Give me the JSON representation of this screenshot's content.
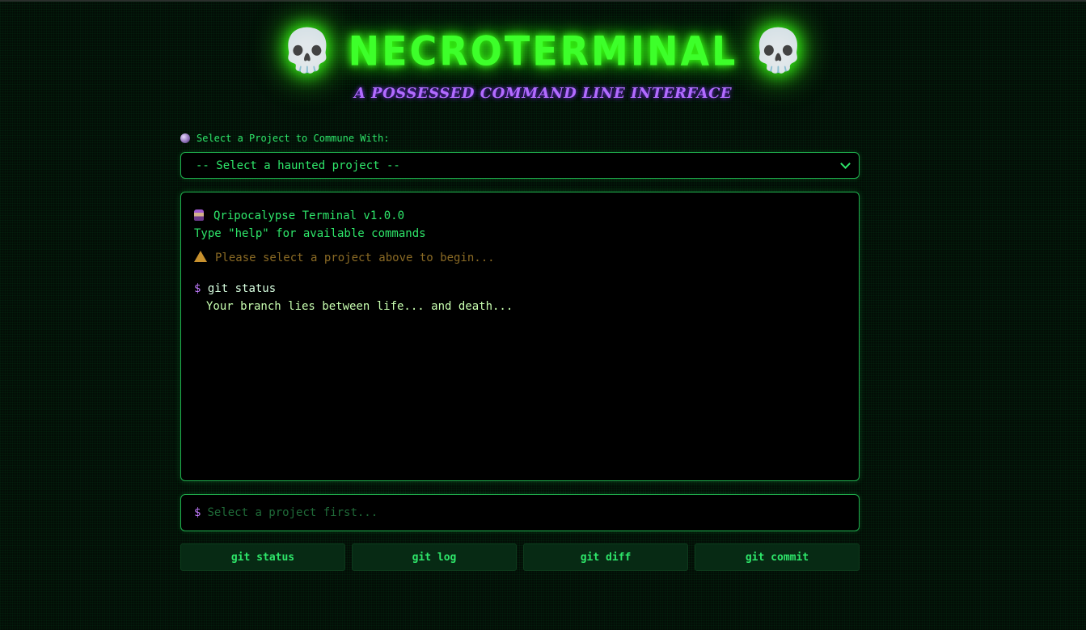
{
  "header": {
    "skull_glyph": "💀",
    "title": "NECROTERMINAL",
    "subtitle": "A POSSESSED COMMAND LINE INTERFACE"
  },
  "project_select": {
    "label": "Select a Project to Commune With:",
    "label_icon": "crystal-ball-icon",
    "selected_value": "-- Select a haunted project --"
  },
  "terminal": {
    "welcome_icon": "zombie-icon",
    "welcome": "Qripocalypse Terminal v1.0.0",
    "hint": "Type \"help\" for available commands",
    "warning_icon": "warning-icon",
    "warning": "Please select a project above to begin...",
    "prompt_symbol": "$",
    "history": [
      {
        "command": "git status",
        "output": "Your branch lies between life... and death..."
      }
    ]
  },
  "command_input": {
    "prompt_symbol": "$",
    "placeholder": "Select a project first...",
    "value": ""
  },
  "quick_buttons": [
    {
      "label": "git status"
    },
    {
      "label": "git log"
    },
    {
      "label": "git diff"
    },
    {
      "label": "git commit"
    }
  ],
  "colors": {
    "accent_green": "#2ee66a",
    "neon_green": "#3dff2a",
    "purple": "#b26bff",
    "warning_amber": "#8a6a24",
    "border_green": "#1fae4c"
  }
}
